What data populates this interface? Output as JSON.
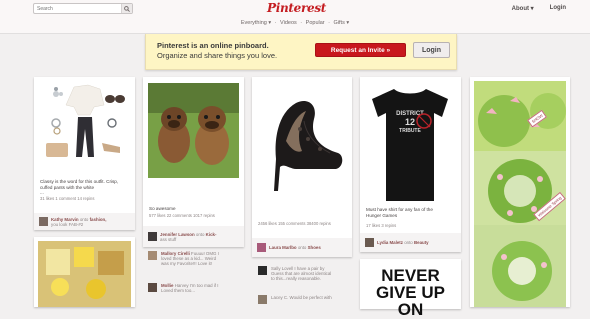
{
  "header": {
    "search_placeholder": "Search",
    "logo": "Pinterest",
    "nav": [
      "Everything ▾",
      "·",
      "Videos",
      "·",
      "Popular",
      "·",
      "Gifts ▾"
    ],
    "about": "About ▾",
    "login": "Login"
  },
  "banner": {
    "line1": "Pinterest is an online pinboard.",
    "line2": "Organize and share things you love.",
    "invite": "Request an Invite »",
    "login": "Login"
  },
  "pins": [
    {
      "desc": [
        "Classy is the word for this outfit. Crisp,",
        "cuffed pants with the white",
        "...",
        "31 likes 1 comment 14 repins"
      ],
      "attr": {
        "user": "Kathy Marvin",
        "via": "onto",
        "board": "fashion,",
        "extra": "you look FAB-#2"
      }
    },
    {
      "desc": [
        "So awesome"
      ],
      "stats": "577 likes  22 comments  1017 repins",
      "attr": {
        "user": "Jennifer Lawson",
        "via": "onto",
        "board": "Kick-",
        "extra": "ass stuff"
      },
      "comments": [
        {
          "user": "Mallory Cirelli",
          "text": [
            "Fuuuu! OMG I",
            "loved these as a kid... Weird",
            "was my Favorite!!! Love it!"
          ]
        },
        {
          "user": "Mollie",
          "text": [
            "Harvey I'm too mad if I",
            "Loved them too..."
          ]
        }
      ]
    },
    {
      "stats": "2456 likes  155 comments  38400 repins",
      "attr": {
        "user": "Laura Marlbo",
        "via": "onto",
        "board": "Shoes"
      },
      "comments": [
        {
          "user": "",
          "text": [
            "Sally Lovell I have a pair by",
            "Guess that are almost identical",
            "to this...really reasonable."
          ]
        },
        {
          "user": "",
          "text": [
            "Lacey C. Would be perfect with"
          ]
        }
      ]
    },
    {
      "desc": [
        "Must have shirt for any fan of the",
        "Hunger Games"
      ],
      "stats": "17 likes  3 repins",
      "attr": {
        "user": "Lydia Maletz",
        "via": "onto",
        "board": "Beauty"
      },
      "poster": [
        "NEVER",
        "GIVE UP ON"
      ]
    },
    {
      "tags": [
        "SHOW",
        "Welcome Spring"
      ]
    }
  ],
  "shirt": {
    "title": "DISTRICT",
    "num": "12",
    "sub": "TRIBUTE"
  },
  "colors": {
    "brand": "#c41d21",
    "banner": "#fef5c4",
    "invite": "#c8171d",
    "background": "#f2f0f0"
  }
}
